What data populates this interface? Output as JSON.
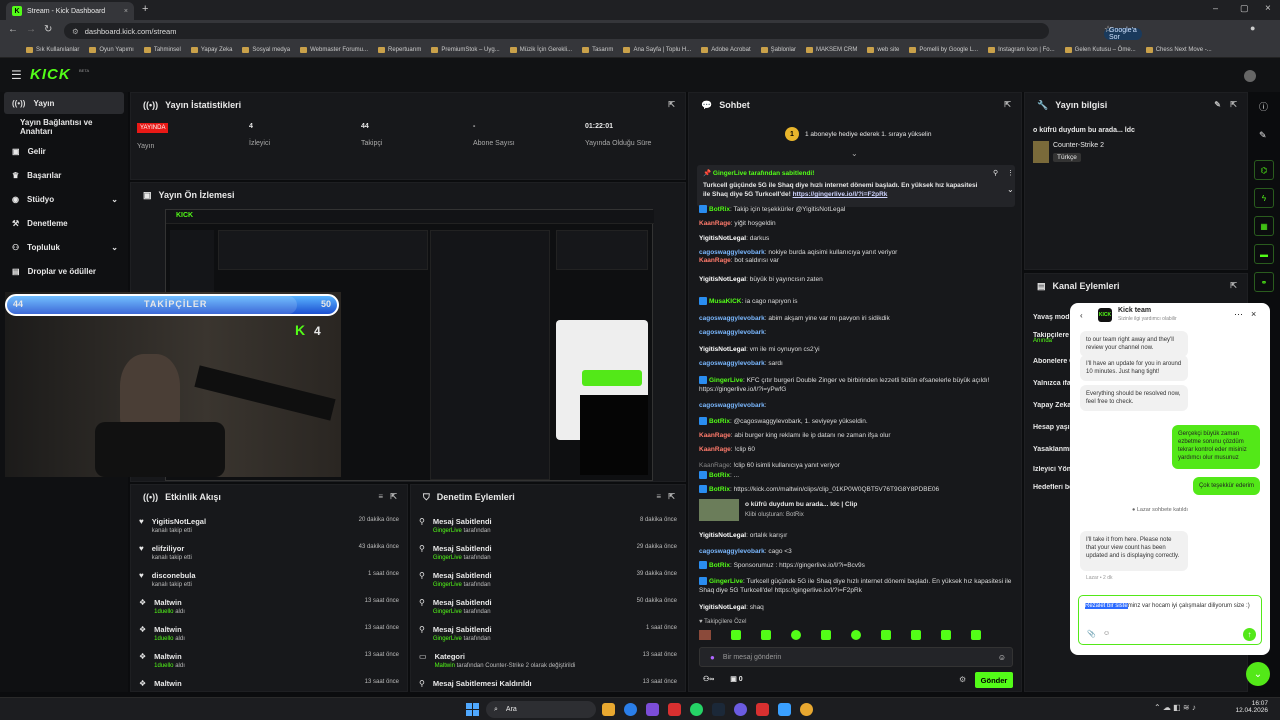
{
  "browser": {
    "tab_title": "Stream - Kick Dashboard",
    "url": "dashboard.kick.com/stream",
    "google_search_label": "Google'a Sor",
    "bookmarks": [
      "Sık Kullanılanlar",
      "Oyun Yapımı",
      "Tahminsel",
      "Yapay Zeka",
      "Sosyal medya",
      "Webmaster Forumu...",
      "Repertuarım",
      "PremiumStok – Uyg...",
      "Müzik İçin Gerekli...",
      "Tasarım",
      "Ana Sayfa | Toplu H...",
      "Adobe Acrobat",
      "Şablonlar",
      "MAKSEM CRM",
      "web site",
      "Pomelli by Google L...",
      "Instagram Icon | Fo...",
      "Gelen Kutusu – Öme...",
      "Chess Next Move -..."
    ]
  },
  "nav": {
    "logo": "KICK",
    "beta": "BETA"
  },
  "sidebar": {
    "items": [
      {
        "label": "Yayın",
        "active": true
      },
      {
        "label": "Yayın Bağlantısı ve Anahtarı"
      },
      {
        "label": "Gelir"
      },
      {
        "label": "Başarılar"
      },
      {
        "label": "Stüdyo"
      },
      {
        "label": "Denetleme"
      },
      {
        "label": "Topluluk"
      },
      {
        "label": "Droplar ve ödüller"
      }
    ]
  },
  "stats": {
    "title": "Yayın İstatistikleri",
    "live_badge": "YAYINDA",
    "cells": [
      {
        "value": "",
        "label": "Yayın"
      },
      {
        "value": "4",
        "label": "İzleyici"
      },
      {
        "value": "44",
        "label": "Takipçi"
      },
      {
        "value": "-",
        "label": "Abone Sayısı"
      },
      {
        "value": "01:22:01",
        "label": "Yayında Olduğu Süre"
      }
    ]
  },
  "preview": {
    "title": "Yayın Ön İzlemesi"
  },
  "follower_goal": {
    "label": "TAKİPÇİLER",
    "current": "44",
    "target": "50",
    "progress": 0.88,
    "viewers": "4"
  },
  "activity": {
    "title": "Etkinlik Akışı",
    "rows": [
      {
        "name": "YigitisNotLegal",
        "sub": "kanalı takip etti",
        "time": "20 dakika önce"
      },
      {
        "name": "elifziliyor",
        "sub": "kanalı takip etti",
        "time": "43 dakika önce"
      },
      {
        "name": "disconebula",
        "sub": "kanalı takip etti",
        "time": "1 saat önce"
      },
      {
        "name": "Maltwin",
        "sub_pre": "",
        "sub_hl": "1duello",
        "sub_post": "aldı",
        "time": "13 saat önce"
      },
      {
        "name": "Maltwin",
        "sub_pre": "",
        "sub_hl": "1duello",
        "sub_post": "aldı",
        "time": "13 saat önce"
      },
      {
        "name": "Maltwin",
        "sub_pre": "",
        "sub_hl": "1duello",
        "sub_post": "aldı",
        "time": "13 saat önce"
      },
      {
        "name": "Maltwin",
        "sub": "",
        "time": "13 saat önce"
      }
    ]
  },
  "moderation": {
    "title": "Denetim Eylemleri",
    "rows": [
      {
        "name": "Mesaj Sabitlendi",
        "by": "GingerLive",
        "suffix": "tarafından",
        "time": "8 dakika önce"
      },
      {
        "name": "Mesaj Sabitlendi",
        "by": "GingerLive",
        "suffix": "tarafından",
        "time": "29 dakika önce"
      },
      {
        "name": "Mesaj Sabitlendi",
        "by": "GingerLive",
        "suffix": "tarafından",
        "time": "39 dakika önce"
      },
      {
        "name": "Mesaj Sabitlendi",
        "by": "GingerLive",
        "suffix": "tarafından",
        "time": "50 dakika önce"
      },
      {
        "name": "Mesaj Sabitlendi",
        "by": "GingerLive",
        "suffix": "tarafından",
        "time": "1 saat önce"
      },
      {
        "name": "Kategori",
        "by": "Maltwin",
        "suffix": "tarafından Counter-Strike 2 olarak değiştirildi",
        "time": "13 saat önce"
      },
      {
        "name": "Mesaj Sabitlemesi Kaldırıldı",
        "by": "",
        "suffix": "",
        "time": "13 saat önce"
      }
    ]
  },
  "chat": {
    "title": "Sohbet",
    "gift_banner": "1 aboneyle hediye ederek 1. sıraya yükselin",
    "pinned_by": "GingerLive tarafından sabitlendi!",
    "pinned_text": "Turkcell güçünde 5G ile Shaq diye hızlı internet dönemi başladı. En yüksek hız kapasitesi ile Shaq diye 5G Turkcell'de!",
    "pinned_link": "https://gingerlive.io/l/?i=F2pRk",
    "messages": [
      {
        "u": "BotRix",
        "c": "u-grn",
        "t": "Takip için teşekkürler @YigitisNotLegal"
      },
      {
        "u": "KaanRage",
        "c": "u-red",
        "t": "yiğit hoşgeldin"
      },
      {
        "u": "YigitisNotLegal",
        "c": "u-wht",
        "t": "darkus"
      },
      {
        "u": "cagoswaggylevobark",
        "c": "u-blu",
        "t": "nokiye burda aqisimi kullanıcıya yanıt veriyor"
      },
      {
        "u": "KaanRage",
        "c": "u-red",
        "t": "bot saldırısı var"
      },
      {
        "u": "YigitisNotLegal",
        "c": "u-wht",
        "t": "büyük bi yayıncısın zaten"
      },
      {
        "u": "MusaKICK",
        "c": "u-grn",
        "t": "ia cago napıyon is"
      },
      {
        "u": "cagoswaggylevobark",
        "c": "u-blu",
        "t": "abim akşam yine var mı pavyon iri sidikdik"
      },
      {
        "u": "cagoswaggylevobark",
        "c": "u-blu",
        "t": ""
      },
      {
        "u": "YigitisNotLegal",
        "c": "u-wht",
        "t": "vm ile mi oynuyon cs2'yi"
      },
      {
        "u": "cagoswaggylevobark",
        "c": "u-blu",
        "t": "sardı"
      },
      {
        "u": "GingerLive",
        "c": "u-grn",
        "t": "KFC çıtır burgeri Double Zinger ve birbirinden lezzetli bütün efsanelerle büyük açıldı! https://gingerlive.io/l/?i=yPwfG"
      },
      {
        "u": "cagoswaggylevobark",
        "c": "u-blu",
        "t": ""
      },
      {
        "u": "BotRix",
        "c": "u-grn",
        "t": "@cagoswaggylevobark, 1. seviyeye yükseldin."
      },
      {
        "u": "KaanRage",
        "c": "u-red",
        "t": "abi burger king reklamı ile ip datanı ne zaman ifşa olur"
      },
      {
        "u": "KaanRage",
        "c": "u-red",
        "t": "!clip 60"
      },
      {
        "u": "KaanRage",
        "c": "u-gry",
        "t": "!clip 60 isimli kullanıcıya yanıt veriyor"
      },
      {
        "u": "BotRix",
        "c": "u-grn",
        "t": "..."
      },
      {
        "u": "BotRix",
        "c": "u-grn",
        "t": "https://kick.com/maltwin/clips/clip_01KP0W0QBT5V76T9G8Y8PDBE06"
      }
    ],
    "clip_title": "o küfrü duydum bu arada... ldc | Clip",
    "clip_sub": "Klibi oluşturan: BotRix",
    "messages2": [
      {
        "u": "YigitisNotLegal",
        "c": "u-wht",
        "t": "ortalık karışır"
      },
      {
        "u": "cagoswaggylevobark",
        "c": "u-blu",
        "t": "cago <3"
      },
      {
        "u": "BotRix",
        "c": "u-grn",
        "t": "Sponsorumuz : https://gingerlive.io/l/?i=Bcv9s"
      },
      {
        "u": "GingerLive",
        "c": "u-grn",
        "t": "Turkcell güçünde 5G ile Shaq diye hızlı internet dönemi başladı. En yüksek hız kapasitesi ile Shaq diye 5G Turkcell'de! https://gingerlive.io/l/?i=F2pRk"
      },
      {
        "u": "YigitisNotLegal",
        "c": "u-wht",
        "t": "shaq"
      }
    ],
    "followers_only": "Takipçilere Özel",
    "input_placeholder": "Bir mesaj gönderin",
    "points": "0",
    "send_label": "Gönder"
  },
  "stream_info": {
    "title": "Yayın bilgisi",
    "stream_title": "o küfrü duydum bu arada... ldc",
    "category": "Counter-Strike 2",
    "language": "Türkçe"
  },
  "channel_actions": {
    "title": "Kanal Eylemleri",
    "items": [
      "Yavaş mod",
      "Takipçilere Özel",
      "Abonelere Özel",
      "Yalnızca ifa",
      "Yapay Zeka",
      "Hesap yaşı",
      "Yasaklanmış",
      "İzleyici Yönetimi",
      "Hedefleri belirle"
    ],
    "sub_green": "Anında"
  },
  "zendesk": {
    "agent": "Kick team",
    "agent_sub": "Sizinle ilgi yardımcı olabilir",
    "bubbles": [
      "to our team right away and they'll review your channel now.",
      "I'll have an update for you in around 10 minutes. Just hang tight!",
      "Everything should be resolved now, feel free to check."
    ],
    "user1": "Gerçekçi büyük zaman ezbetme sorunu çözdüm tekrar kontrol eder misiniz yardımcı olur musunuz",
    "user2": "Çok teşekkür ederim",
    "joined": "Lazar sohbete katıldı",
    "reply": "I'll take it from here. Please note that your view count has been updated and is displaying correctly.",
    "reply_meta": "Lazar • 2 dk",
    "input_sel": "Rezalet bir siste",
    "input_rest": "minz var hocam iyi çalışmalar diliyorum size :)"
  },
  "taskbar": {
    "search": "Ara",
    "time": "16:07",
    "date": "12.04.2026"
  },
  "colors": {
    "accent": "#53fc18",
    "live": "#e91916",
    "bg": "#0b0c0e",
    "panel": "#17181b"
  }
}
